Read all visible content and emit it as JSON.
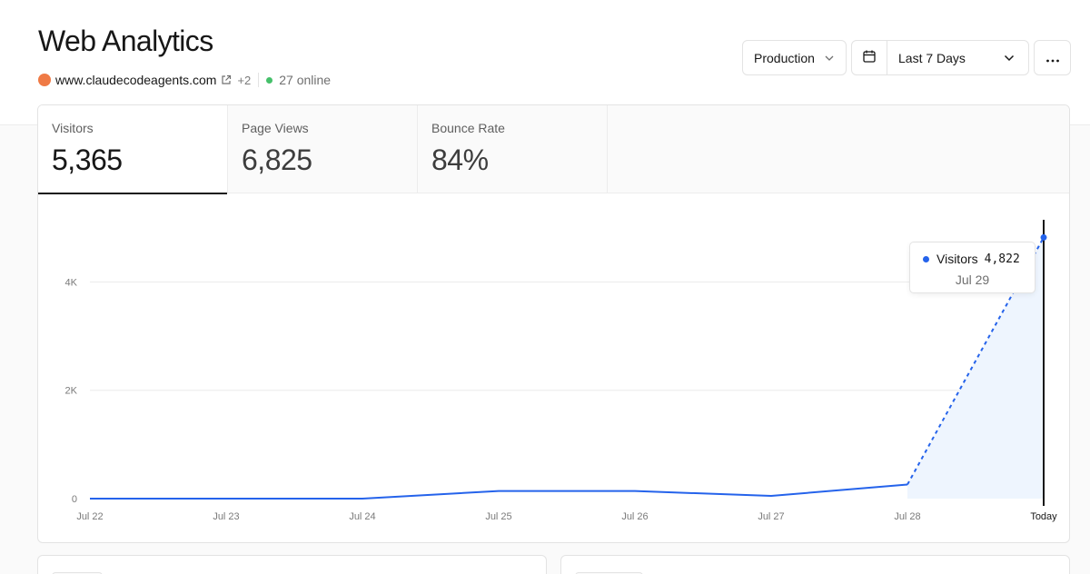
{
  "header": {
    "title": "Web Analytics",
    "site": {
      "domain": "www.claudecodeagents.com",
      "extra_count": "+2",
      "online": "27 online",
      "favicon_color": "#ef7a45"
    }
  },
  "toolbar": {
    "environment": "Production",
    "date_range": "Last 7 Days"
  },
  "metrics": [
    {
      "label": "Visitors",
      "value": "5,365"
    },
    {
      "label": "Page Views",
      "value": "6,825"
    },
    {
      "label": "Bounce Rate",
      "value": "84%"
    }
  ],
  "tooltip": {
    "series": "Visitors",
    "value": "4,822",
    "date": "Jul 29"
  },
  "chart_data": {
    "type": "area",
    "title": "",
    "xlabel": "",
    "ylabel": "",
    "categories": [
      "Jul 22",
      "Jul 23",
      "Jul 24",
      "Jul 25",
      "Jul 26",
      "Jul 27",
      "Jul 28",
      "Today"
    ],
    "series": [
      {
        "name": "Visitors",
        "values": [
          0,
          0,
          0,
          140,
          140,
          50,
          260,
          4822
        ]
      }
    ],
    "y_ticks": [
      "0",
      "2K",
      "4K"
    ],
    "y_tick_values": [
      0,
      2000,
      4000
    ],
    "ylim": [
      0,
      5500
    ],
    "grid": true,
    "last_segment_dashed": true,
    "colors": {
      "line": "#2563eb",
      "area": "#eef5fe",
      "cursor": "#171717"
    }
  }
}
